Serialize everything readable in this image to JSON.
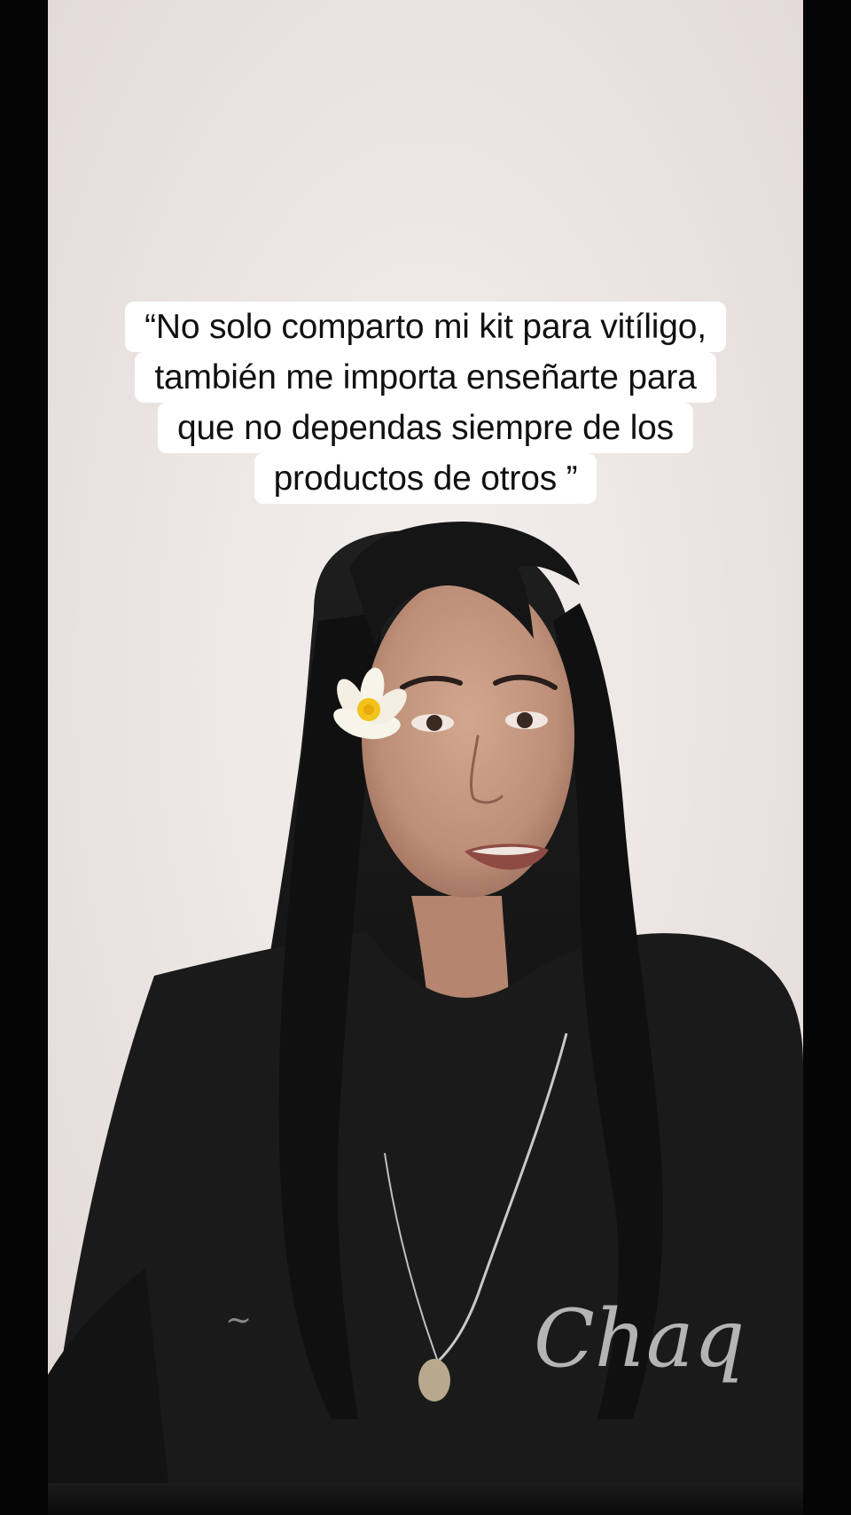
{
  "caption": {
    "lines": [
      "“No solo comparto mi kit para vitíligo,",
      "también me importa enseñarte para",
      "que no dependas siempre de los",
      "productos de otros ”"
    ]
  },
  "scene": {
    "subject": "woman-speaking-to-camera",
    "hair_ornament": "plumeria-flower",
    "shirt_print": "Chaq"
  },
  "colors": {
    "background_wall": "#ece7e4",
    "caption_bg": "#ffffff",
    "caption_text": "#111111",
    "hair": "#141414",
    "shirt": "#1a1a1a",
    "skin": "#c89a82",
    "flower_petal": "#f7f4ea",
    "flower_center": "#f2c318"
  }
}
